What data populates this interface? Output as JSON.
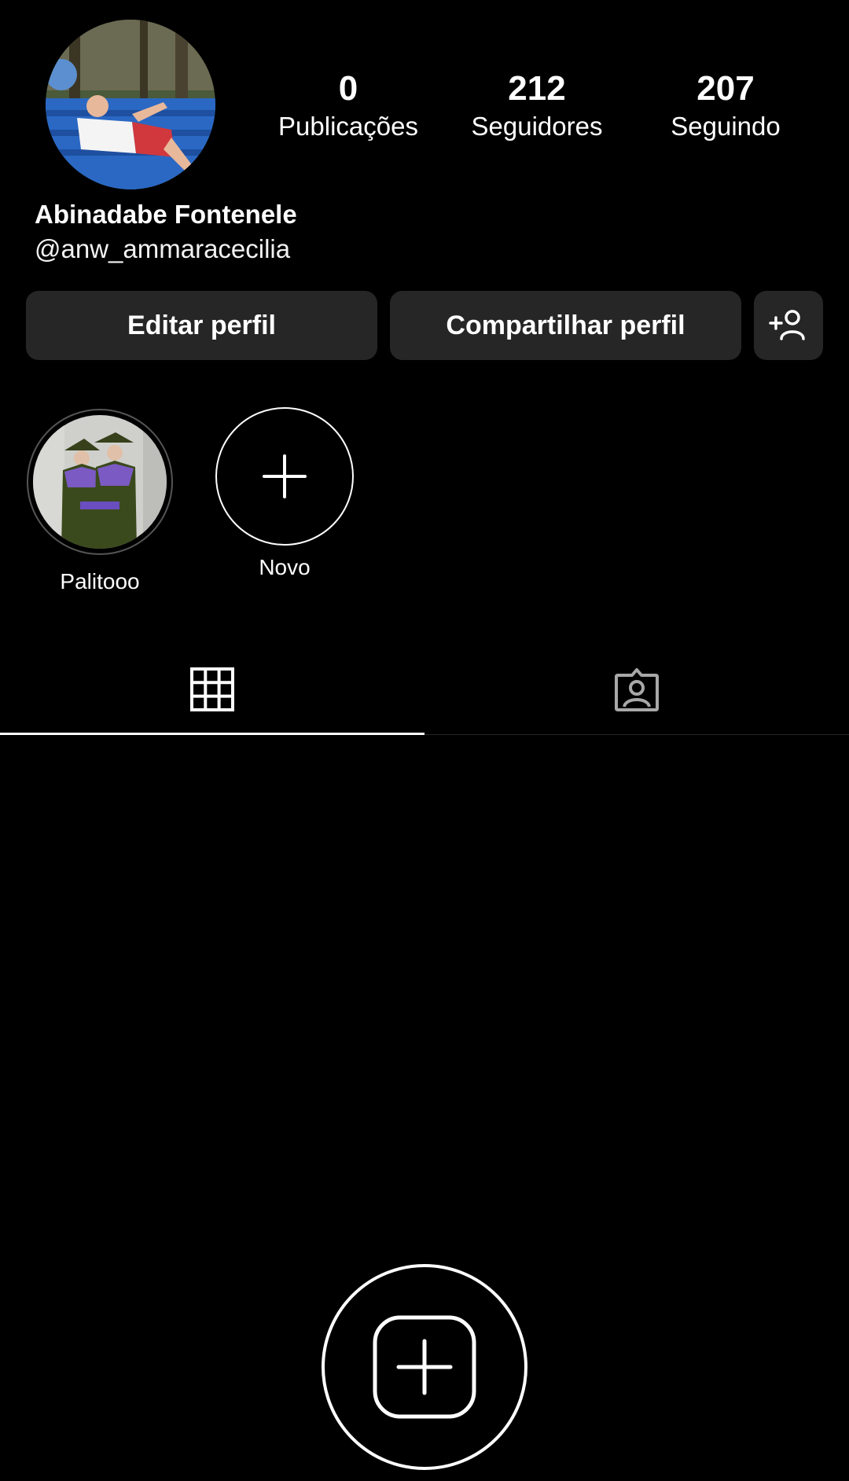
{
  "profile": {
    "display_name": "Abinadabe Fontenele",
    "username": "@anw_ammaracecilia",
    "avatar_icon": "profile-photo"
  },
  "stats": [
    {
      "count": "0",
      "label": "Publicações"
    },
    {
      "count": "212",
      "label": "Seguidores"
    },
    {
      "count": "207",
      "label": "Seguindo"
    }
  ],
  "actions": {
    "edit_label": "Editar perfil",
    "share_label": "Compartilhar perfil",
    "discover_icon": "add-person-icon"
  },
  "highlights": [
    {
      "label": "Palitooo",
      "icon": "highlight-cover-photo"
    },
    {
      "label": "Novo",
      "icon": "plus-icon"
    }
  ],
  "tabs": [
    {
      "name": "posts-grid",
      "icon": "grid-icon",
      "active": true
    },
    {
      "name": "tagged",
      "icon": "tagged-person-icon",
      "active": false
    }
  ],
  "empty_state": {
    "icon": "create-post-icon"
  },
  "colors": {
    "background": "#000000",
    "button_bg": "#262626",
    "text": "#ffffff",
    "tab_inactive": "#a8a8a8"
  }
}
